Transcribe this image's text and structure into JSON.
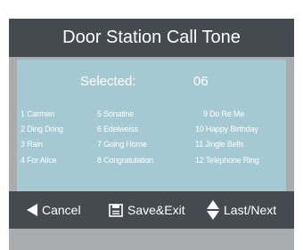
{
  "title": "Door Station Call Tone",
  "selection": {
    "label": "Selected:",
    "value": "06"
  },
  "tones": {
    "col1": [
      "1 Carmen",
      "2 Ding Dong",
      "3 Rain",
      "4 For Alice"
    ],
    "col2": [
      "5 Sonatine",
      "6 Edelweiss",
      "7 Going Home",
      "8 Congratulation"
    ],
    "col3": [
      "9 Do Re Me",
      "10 Happy Birthday",
      "11 Jingle Bells",
      "12 Telephone Ring"
    ]
  },
  "footer": {
    "cancel_label": "Cancel",
    "save_label": "Save&Exit",
    "nav_label": "Last/Next",
    "cancel_icon": "left-arrow-icon",
    "save_icon": "save-icon",
    "nav_icon": "up-down-arrow-icon"
  },
  "colors": {
    "titlebar": "#454a50",
    "panel": "#a5c9d3",
    "screen": "#a9acae",
    "text": "#ffffff"
  }
}
